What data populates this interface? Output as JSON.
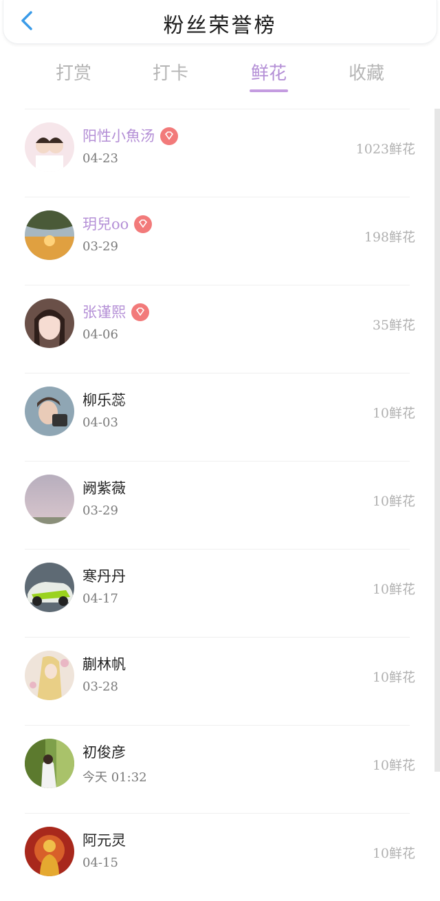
{
  "header": {
    "title": "粉丝荣誉榜"
  },
  "tabs": [
    {
      "label": "打赏"
    },
    {
      "label": "打卡"
    },
    {
      "label": "鲜花"
    },
    {
      "label": "收藏"
    }
  ],
  "active_tab": "鲜花",
  "colors": {
    "accent": "#b48fd6",
    "badge": "#f27a7a",
    "back": "#3a9be8"
  },
  "fans": [
    {
      "name": "阳性小魚汤",
      "date": "04-23",
      "amount": "1023鲜花",
      "vip": true
    },
    {
      "name": "玥兒oo",
      "date": "03-29",
      "amount": "198鲜花",
      "vip": true
    },
    {
      "name": "张谨熙",
      "date": "04-06",
      "amount": "35鲜花",
      "vip": true
    },
    {
      "name": "柳乐蕊",
      "date": "04-03",
      "amount": "10鲜花",
      "vip": false
    },
    {
      "name": "阙紫薇",
      "date": "03-29",
      "amount": "10鲜花",
      "vip": false
    },
    {
      "name": "寒丹丹",
      "date": "04-17",
      "amount": "10鲜花",
      "vip": false
    },
    {
      "name": "蒯林帆",
      "date": "03-28",
      "amount": "10鲜花",
      "vip": false
    },
    {
      "name": "初俊彦",
      "date": "今天 01:32",
      "amount": "10鲜花",
      "vip": false
    },
    {
      "name": "阿元灵",
      "date": "04-15",
      "amount": "10鲜花",
      "vip": false
    }
  ]
}
